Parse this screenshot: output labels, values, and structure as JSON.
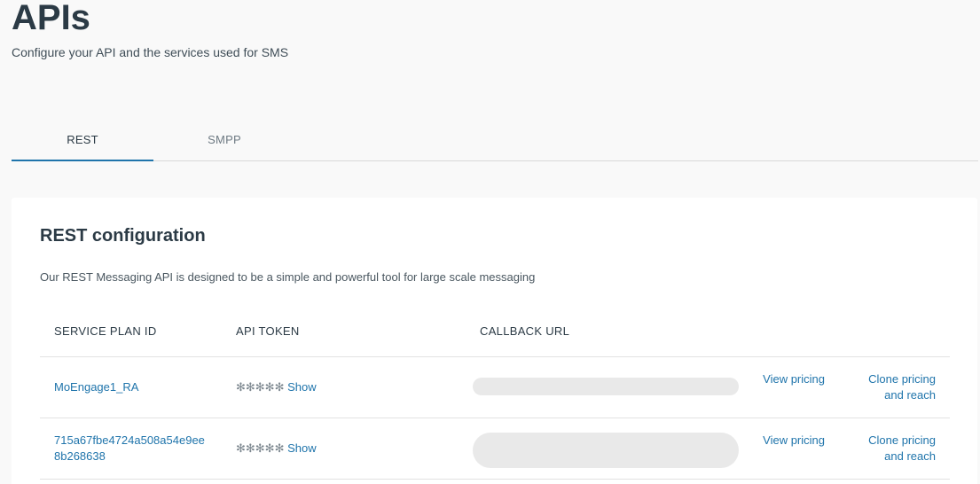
{
  "header": {
    "title": "APIs",
    "subtitle": "Configure your API and the services used for SMS"
  },
  "tabs": [
    {
      "label": "REST",
      "active": true
    },
    {
      "label": "SMPP",
      "active": false
    }
  ],
  "rest": {
    "title": "REST configuration",
    "description": "Our REST Messaging API is designed to be a simple and powerful tool for large scale messaging",
    "columns": {
      "service_plan_id": "SERVICE PLAN ID",
      "api_token": "API TOKEN",
      "callback_url": "CALLBACK URL"
    },
    "rows": [
      {
        "service_plan_id": "MoEngage1_RA",
        "token_mask": "✻✻✻✻✻",
        "show_label": "Show",
        "callback_url": "",
        "view_pricing_label": "View pricing",
        "clone_label": "Clone pricing and reach"
      },
      {
        "service_plan_id": "715a67fbe4724a508a54e9ee8b268638",
        "token_mask": "✻✻✻✻✻",
        "show_label": "Show",
        "callback_url": "",
        "view_pricing_label": "View pricing",
        "clone_label": "Clone pricing and reach"
      }
    ]
  },
  "colors": {
    "accent": "#1f74ab",
    "title_text": "#2b3a45",
    "page_bg": "#f9f9f9",
    "card_bg": "#ffffff",
    "placeholder": "#e9e9e9"
  }
}
